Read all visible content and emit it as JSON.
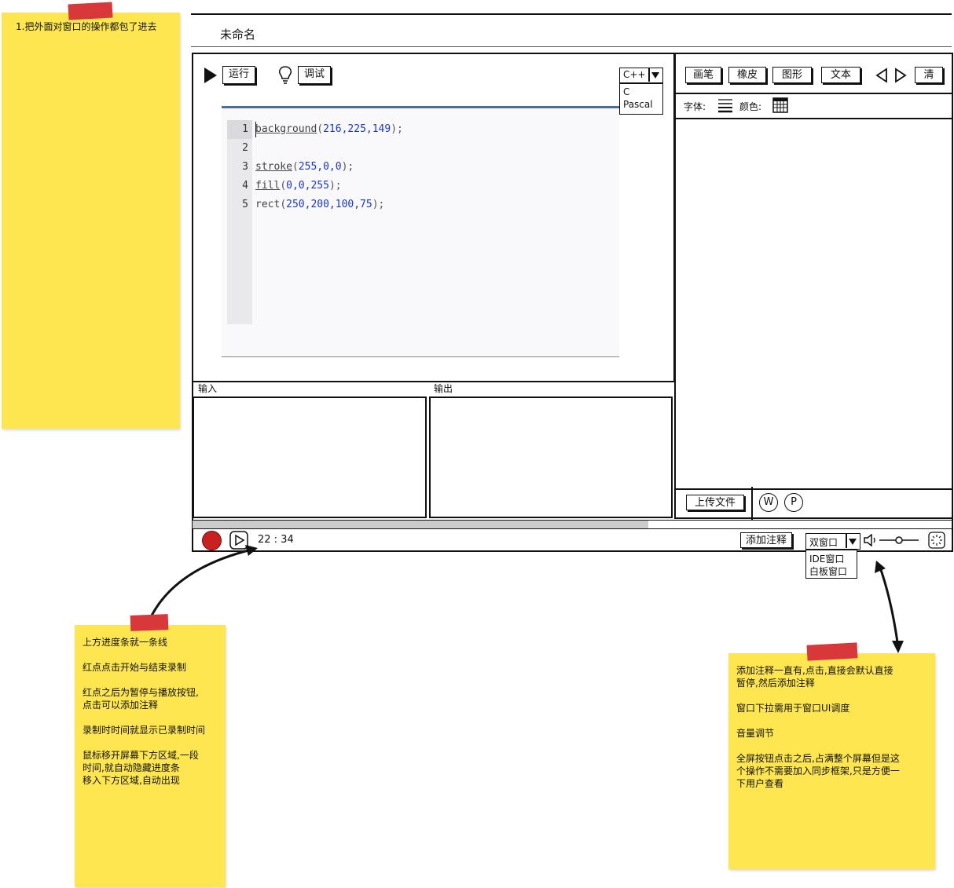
{
  "notes": {
    "top_left": "1.把外面对窗口的操作都包了进去",
    "bottom_left": "上方进度条就一条线\n\n红点点击开始与结束录制\n\n红点之后为暂停与播放按钮,\n点击可以添加注释\n\n录制时时间就显示已录制时间\n\n鼠标移开屏幕下方区域,一段\n时间,就自动隐藏进度条\n移入下方区域,自动出现",
    "bottom_right": "添加注释一直有,点击,直接会默认直接\n暂停,然后添加注释\n\n窗口下拉需用于窗口UI调度\n\n音量调节\n\n全屏按钮点击之后,占满整个屏幕但是这\n个操作不需要加入同步框架,只是方便一\n下用户查看"
  },
  "window": {
    "title": "未命名"
  },
  "ide": {
    "run_label": "运行",
    "debug_label": "调试",
    "language": {
      "selected": "C++",
      "options": [
        "C",
        "Pascal"
      ]
    },
    "code": {
      "line_numbers": [
        "1",
        "2",
        "3",
        "4",
        "5"
      ],
      "lines": [
        {
          "fn": "background",
          "args": "216,225,149"
        },
        {
          "fn": "",
          "args": ""
        },
        {
          "fn": "stroke",
          "args": "255,0,0"
        },
        {
          "fn": "fill",
          "args": "0,0,255"
        },
        {
          "fn": "rect",
          "args": "250,200,100,75"
        }
      ]
    },
    "input_label": "输入",
    "output_label": "输出"
  },
  "whiteboard": {
    "tools": [
      "画笔",
      "橡皮",
      "图形",
      "文本"
    ],
    "clear_label": "清",
    "font_label": "字体:",
    "color_label": "颜色:",
    "upload_label": "上传文件",
    "w_label": "W",
    "p_label": "P"
  },
  "player": {
    "time": "22 : 34",
    "add_note_label": "添加注释",
    "window_select": {
      "selected": "双窗口",
      "options": [
        "IDE窗口",
        "白板窗口"
      ]
    },
    "progress": 0.6
  },
  "colors": {
    "note": "#fde64f",
    "tape": "#d9383a",
    "record": "#c8211f",
    "code_number": "#1a37c4",
    "editor_rule": "#4b6e9a"
  }
}
